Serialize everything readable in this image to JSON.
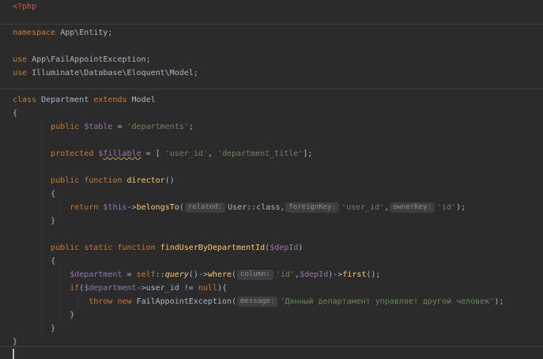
{
  "editor": {
    "php_open": "<?php",
    "namespace_kw": "namespace",
    "namespace_name": " App\\Entity;",
    "use_kw": "use",
    "use1_name": " App\\FailAppointException;",
    "use2_name": " Illuminate\\Database\\Eloquent\\Model;",
    "class_kw": "class",
    "class_name": " Department ",
    "extends_kw": "extends",
    "parent_name": " Model",
    "brace_open": "{",
    "brace_close": "}",
    "public_kw": "public",
    "protected_kw": "protected",
    "static_kw": "static",
    "function_kw": "function",
    "return_kw": "return",
    "if_kw": "if",
    "throw_kw": "throw",
    "new_kw": "new",
    "table_var": "$table",
    "table_value": "'departments'",
    "fillable_dollar": "$",
    "fillable_name": "fillable",
    "fillable_v1": "'user_id'",
    "fillable_v2": "'department_title'",
    "director_fn": "director",
    "this_var": "$this",
    "belongsTo_fn": "belongsTo",
    "hint_related": "related:",
    "user_class": "User::class,",
    "hint_foreign": "foreignKey:",
    "arg_user_id": "'user_id'",
    "hint_owner": "ownerKey:",
    "arg_id": "'id'",
    "find_fn": "findUserByDepartmentId",
    "dep_id_var": "$depId",
    "department_var": "$department",
    "self_kw": "self",
    "query_fn": "query",
    "where_fn": "where",
    "hint_column": "column:",
    "first_fn": "first",
    "user_id_prop": "->user_id",
    "null_kw": "null",
    "exception_class": "FailAppointException",
    "hint_message": "message:",
    "message_str": "'Данный департамент управляет другой человек'"
  }
}
